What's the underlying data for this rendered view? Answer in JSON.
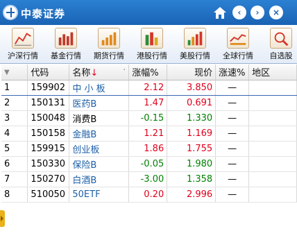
{
  "app": {
    "title": "中泰证券"
  },
  "titlebar": {
    "back": "‹",
    "forward": "›",
    "close": "×"
  },
  "toolbar": [
    {
      "label": "沪深行情",
      "icon": "line-chart-icon"
    },
    {
      "label": "基金行情",
      "icon": "bar-chart-icon"
    },
    {
      "label": "期货行情",
      "icon": "futures-chart-icon"
    },
    {
      "label": "港股行情",
      "icon": "hk-stock-chart-icon"
    },
    {
      "label": "美股行情",
      "icon": "us-stock-chart-icon"
    },
    {
      "label": "全球行情",
      "icon": "global-chart-icon"
    },
    {
      "label": "自选股",
      "icon": "watchlist-icon"
    }
  ],
  "table": {
    "headers": [
      "代码",
      "名称",
      "涨幅%",
      "现价",
      "涨速%",
      "地区"
    ],
    "sort_arrow": "↓",
    "dot": "·",
    "rows": [
      {
        "idx": "1",
        "code": "159902",
        "name": "中 小 板",
        "chg": "2.12",
        "price": "3.850",
        "speed": "—",
        "area": ""
      },
      {
        "idx": "2",
        "code": "150131",
        "name": "医药B",
        "chg": "1.47",
        "price": "0.691",
        "speed": "—",
        "area": ""
      },
      {
        "idx": "3",
        "code": "150048",
        "name": "消费B",
        "chg": "-0.15",
        "price": "1.330",
        "speed": "—",
        "area": ""
      },
      {
        "idx": "4",
        "code": "150158",
        "name": "金融B",
        "chg": "1.21",
        "price": "1.169",
        "speed": "—",
        "area": ""
      },
      {
        "idx": "5",
        "code": "159915",
        "name": "创业板",
        "chg": "1.86",
        "price": "1.755",
        "speed": "—",
        "area": ""
      },
      {
        "idx": "6",
        "code": "150330",
        "name": "保险B",
        "chg": "-0.05",
        "price": "1.980",
        "speed": "—",
        "area": ""
      },
      {
        "idx": "7",
        "code": "150270",
        "name": "白酒B",
        "chg": "-3.00",
        "price": "1.358",
        "speed": "—",
        "area": ""
      },
      {
        "idx": "8",
        "code": "510050",
        "name": "50ETF",
        "chg": "0.20",
        "price": "2.996",
        "speed": "—",
        "area": ""
      }
    ]
  },
  "colors": {
    "titlebar": "#1a63b4",
    "up": "#e0001b",
    "down": "#008000",
    "name_link": "#1d5fa8"
  }
}
